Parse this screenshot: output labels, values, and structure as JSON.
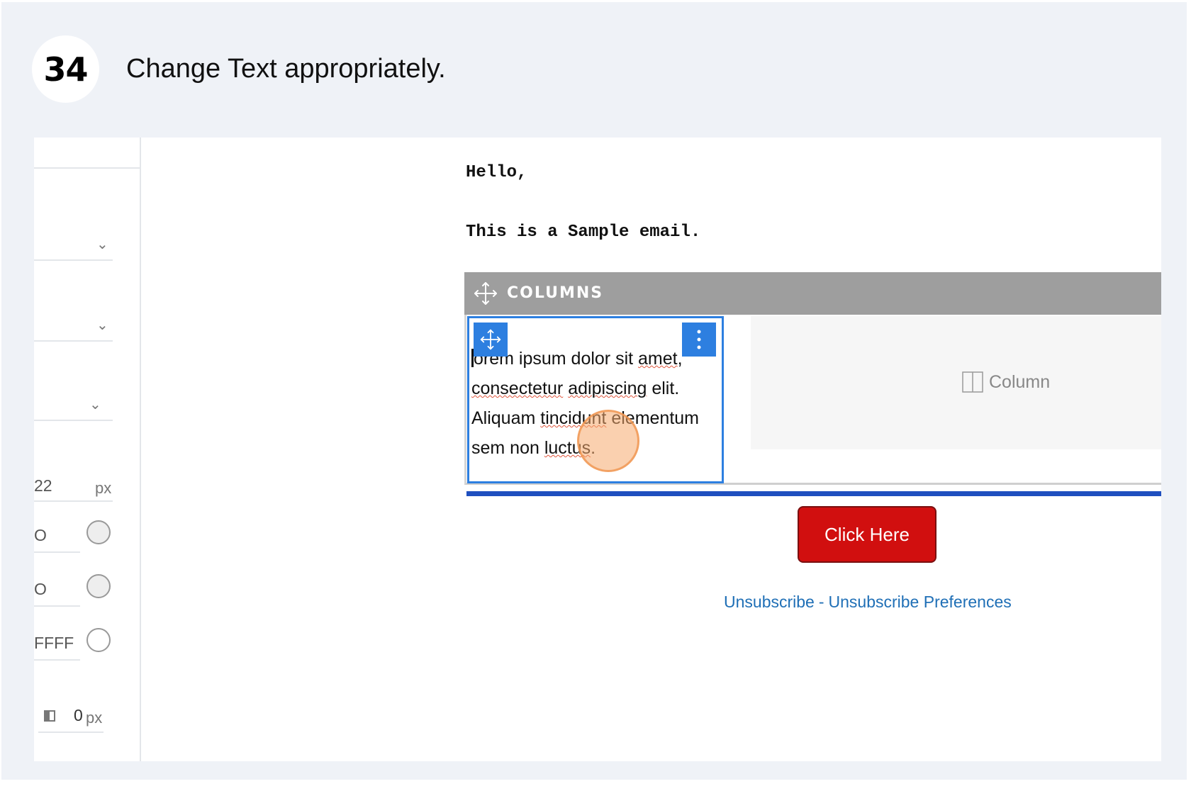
{
  "step": {
    "number": "34",
    "instruction": "Change Text appropriately."
  },
  "sidebar": {
    "fields": [
      {
        "value": "22",
        "unit": "px"
      },
      {
        "value": "O"
      },
      {
        "value": "O"
      },
      {
        "value": "FFFF"
      },
      {
        "value": "0",
        "unit": "px"
      }
    ]
  },
  "email": {
    "greeting": "Hello,",
    "body": "This is a Sample email.",
    "columns_label": "COLUMNS",
    "column_text_parts": [
      "orem ipsum dolor sit ",
      "amet",
      ",",
      "consectetur",
      " ",
      "adipiscing",
      " elit. Aliquam ",
      "tincidunt",
      " elementum sem non ",
      "luctus",
      "."
    ],
    "empty_column_label": "Column",
    "button_label": "Click Here",
    "links": {
      "unsubscribe": "Unsubscribe",
      "separator": "-",
      "preferences": "Unsubscribe Preferences"
    }
  },
  "colors": {
    "accent": "#2d7fe0",
    "button": "#d10f0f",
    "divider": "#1f4fbf",
    "link": "#1f6fb6",
    "columns_bar": "#9e9e9e"
  }
}
